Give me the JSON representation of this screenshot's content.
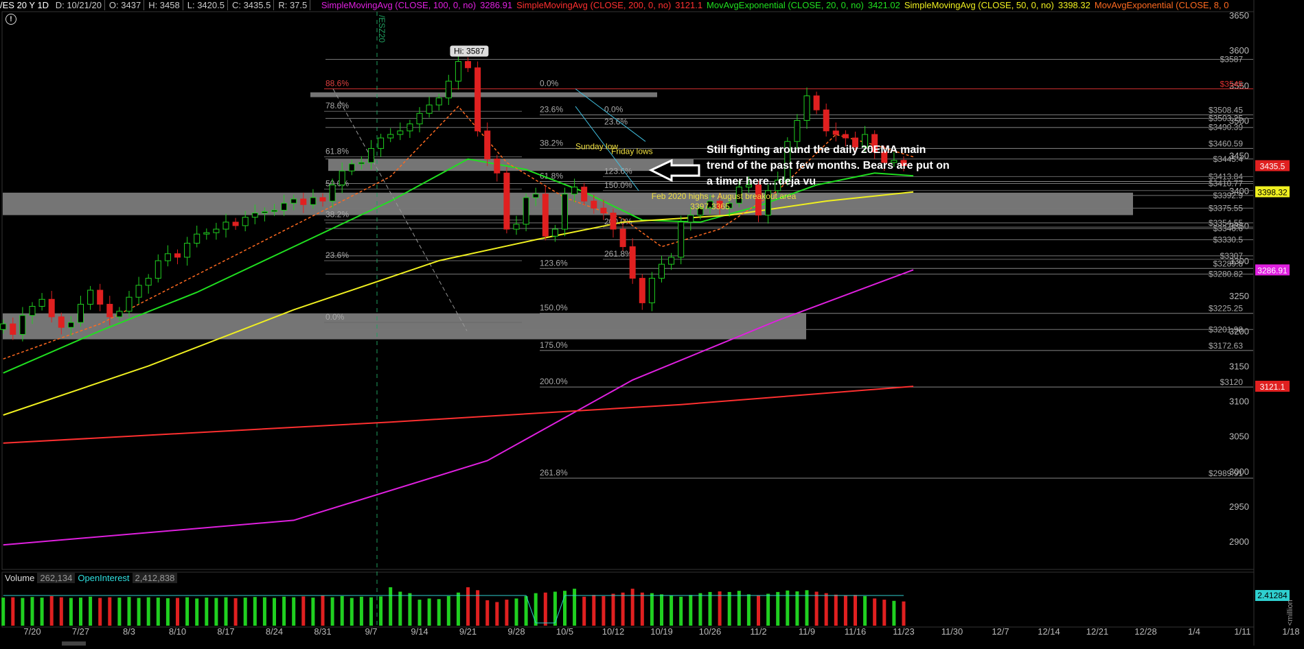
{
  "header": {
    "symbol": "/ES 20 Y 1D",
    "ohlc": [
      {
        "label": "D: 10/21/20",
        "color": "#cccccc"
      },
      {
        "label": "O: 3437",
        "color": "#cccccc"
      },
      {
        "label": "H: 3458",
        "color": "#cccccc"
      },
      {
        "label": "L: 3420.5",
        "color": "#cccccc"
      },
      {
        "label": "C: 3435.5",
        "color": "#cccccc"
      },
      {
        "label": "R: 37.5",
        "color": "#cccccc"
      }
    ],
    "studies": [
      {
        "name": "SimpleMovingAvg (CLOSE, 100, 0, no)",
        "value": "3286.91",
        "color": "#e020e0"
      },
      {
        "name": "SimpleMovingAvg (CLOSE, 200, 0, no)",
        "value": "3121.1",
        "color": "#ff3030"
      },
      {
        "name": "MovAvgExponential (CLOSE, 20, 0, no)",
        "value": "3421.02",
        "color": "#20e020"
      },
      {
        "name": "SimpleMovingAvg (CLOSE, 50, 0, no)",
        "value": "3398.32",
        "color": "#f0f020"
      },
      {
        "name": "MovAvgExponential (CLOSE, 8, 0, no)",
        "value": "",
        "color": "#ff6a20"
      }
    ]
  },
  "warning_glyph": "!",
  "contract_roll_label": "/ESZ20",
  "note": "Still fighting around the daily 20EMA main trend of the past few months. Bears are put on a timer here...deja vu",
  "chart_data": {
    "type": "candlestick",
    "ylim": [
      2860,
      3655
    ],
    "y_ticks": [
      2900,
      2950,
      3000,
      3050,
      3100,
      3150,
      3200,
      3250,
      3300,
      3350,
      3400,
      3450,
      3500,
      3550,
      3600,
      3650
    ],
    "x_ticks": [
      "7/20",
      "7/27",
      "8/3",
      "8/10",
      "8/17",
      "8/24",
      "8/31",
      "9/7",
      "9/14",
      "9/21",
      "9/28",
      "10/5",
      "10/12",
      "10/19",
      "10/26",
      "11/2",
      "11/9",
      "11/16",
      "11/23",
      "11/30",
      "12/7",
      "12/14",
      "12/21",
      "12/28",
      "1/4",
      "1/11",
      "1/18"
    ],
    "bars_per_tick": 5,
    "first_tick_index": 3,
    "hi_label": "Hi: 3587",
    "closes": [
      3210,
      3195,
      3222,
      3235,
      3245,
      3220,
      3205,
      3212,
      3238,
      3258,
      3238,
      3220,
      3228,
      3248,
      3265,
      3275,
      3300,
      3310,
      3305,
      3325,
      3338,
      3340,
      3345,
      3355,
      3350,
      3362,
      3368,
      3370,
      3372,
      3382,
      3388,
      3380,
      3390,
      3385,
      3408,
      3428,
      3438,
      3440,
      3460,
      3475,
      3480,
      3485,
      3495,
      3510,
      3522,
      3532,
      3556,
      3584,
      3575,
      3485,
      3445,
      3425,
      3345,
      3352,
      3390,
      3395,
      3335,
      3345,
      3395,
      3405,
      3385,
      3375,
      3368,
      3345,
      3320,
      3275,
      3240,
      3275,
      3295,
      3305,
      3355,
      3365,
      3375,
      3385,
      3375,
      3382,
      3405,
      3408,
      3365,
      3400,
      3415,
      3470,
      3500,
      3535,
      3515,
      3485,
      3480,
      3475,
      3462,
      3480,
      3455,
      3440,
      3443,
      3435.5
    ],
    "volume": [
      95,
      96,
      94,
      97,
      95,
      100,
      96,
      94,
      95,
      98,
      94,
      96,
      95,
      97,
      94,
      96,
      95,
      93,
      94,
      96,
      92,
      95,
      94,
      96,
      93,
      95,
      97,
      96,
      94,
      98,
      96,
      99,
      95,
      101,
      96,
      100,
      94,
      98,
      96,
      99,
      130,
      115,
      110,
      88,
      92,
      90,
      100,
      112,
      130,
      120,
      86,
      80,
      88,
      92,
      100,
      110,
      112,
      115,
      118,
      125,
      98,
      104,
      100,
      108,
      112,
      125,
      112,
      110,
      106,
      102,
      98,
      104,
      110,
      114,
      116,
      114,
      118,
      106,
      102,
      108,
      114,
      119,
      116,
      120,
      115,
      110,
      105,
      102,
      104,
      100,
      92,
      88,
      84,
      82
    ],
    "series": [
      {
        "name": "SMA 100",
        "color": "#e020e0",
        "points": [
          [
            0,
            2895
          ],
          [
            30,
            2930
          ],
          [
            50,
            3015
          ],
          [
            65,
            3130
          ],
          [
            80,
            3215
          ],
          [
            94,
            3287
          ]
        ]
      },
      {
        "name": "SMA 200",
        "color": "#ff3030",
        "points": [
          [
            0,
            3040
          ],
          [
            40,
            3070
          ],
          [
            70,
            3095
          ],
          [
            94,
            3121
          ]
        ]
      },
      {
        "name": "EMA 20",
        "color": "#20e020",
        "points": [
          [
            0,
            3140
          ],
          [
            10,
            3200
          ],
          [
            20,
            3255
          ],
          [
            30,
            3320
          ],
          [
            40,
            3385
          ],
          [
            48,
            3445
          ],
          [
            54,
            3430
          ],
          [
            60,
            3398
          ],
          [
            66,
            3358
          ],
          [
            72,
            3355
          ],
          [
            78,
            3378
          ],
          [
            84,
            3408
          ],
          [
            90,
            3425
          ],
          [
            94,
            3421
          ]
        ]
      },
      {
        "name": "SMA 50",
        "color": "#f0f020",
        "points": [
          [
            0,
            3080
          ],
          [
            15,
            3150
          ],
          [
            30,
            3230
          ],
          [
            45,
            3300
          ],
          [
            55,
            3330
          ],
          [
            64,
            3355
          ],
          [
            75,
            3365
          ],
          [
            85,
            3385
          ],
          [
            94,
            3398
          ]
        ]
      },
      {
        "name": "EMA 8",
        "color": "#ff6a20",
        "points": [
          [
            0,
            3160
          ],
          [
            10,
            3210
          ],
          [
            20,
            3280
          ],
          [
            30,
            3350
          ],
          [
            40,
            3420
          ],
          [
            47,
            3520
          ],
          [
            52,
            3440
          ],
          [
            58,
            3390
          ],
          [
            64,
            3360
          ],
          [
            68,
            3320
          ],
          [
            74,
            3345
          ],
          [
            80,
            3400
          ],
          [
            86,
            3480
          ],
          [
            90,
            3465
          ],
          [
            94,
            3448
          ]
        ]
      }
    ],
    "right_axis_badges": [
      {
        "label": "3435.5",
        "value": 3435.5,
        "color": "#e02020"
      },
      {
        "label": "3398.32",
        "value": 3398.32,
        "color": "#f0f020"
      },
      {
        "label": "3286.91",
        "value": 3286.91,
        "color": "#e020e0"
      },
      {
        "label": "3121.1",
        "value": 3121.1,
        "color": "#e02020"
      }
    ],
    "fib_levels": [
      {
        "pct": "0.0%",
        "value": 3545,
        "label": "$3545"
      },
      {
        "pct": "23.6%",
        "value": 3508,
        "label": "$3508.45"
      },
      {
        "pct": "38.2%",
        "value": 3460,
        "label": "$3460.59"
      },
      {
        "pct": "61.8%",
        "value": 3413,
        "label": "$3413.84"
      },
      {
        "pct": "123.6%",
        "value": 3289,
        "label": "$3289.8"
      },
      {
        "pct": "150.0%",
        "value": 3225,
        "label": "$3225.25"
      },
      {
        "pct": "175.0%",
        "value": 3172,
        "label": "$3172.63"
      },
      {
        "pct": "200.0%",
        "value": 3120,
        "label": "$3120"
      },
      {
        "pct": "261.8%",
        "value": 2990,
        "label": "$2989.91"
      }
    ],
    "level_prices": [
      {
        "label": "$3587",
        "value": 3587
      },
      {
        "label": "$3503.25",
        "value": 3503
      },
      {
        "label": "$3490.39",
        "value": 3490
      },
      {
        "label": "$3445.4",
        "value": 3445
      },
      {
        "label": "$3410.77",
        "value": 3410
      },
      {
        "label": "$3392.9",
        "value": 3393
      },
      {
        "label": "$3375.55",
        "value": 3375
      },
      {
        "label": "$3354.55",
        "value": 3354
      },
      {
        "label": "$3346.6",
        "value": 3346
      },
      {
        "label": "$3330.5",
        "value": 3330
      },
      {
        "label": "$3307",
        "value": 3307
      },
      {
        "label": "$3280.82",
        "value": 3281
      },
      {
        "label": "$3201.98",
        "value": 3202
      }
    ],
    "left_fib": [
      {
        "pct": "88.6%",
        "value": 3545
      },
      {
        "pct": "78.6%",
        "value": 3513
      },
      {
        "pct": "61.8%",
        "value": 3448
      },
      {
        "pct": "50.0%",
        "value": 3402
      },
      {
        "pct": "38.2%",
        "value": 3358
      },
      {
        "pct": "23.6%",
        "value": 3300
      },
      {
        "pct": "0.0%",
        "value": 3212
      }
    ],
    "mid_fib": [
      {
        "pct": "0.0%",
        "value": 3508
      },
      {
        "pct": "23.6%",
        "value": 3490
      },
      {
        "pct": "123.6%",
        "value": 3420
      },
      {
        "pct": "150.0%",
        "value": 3400
      },
      {
        "pct": "200.0%",
        "value": 3348
      },
      {
        "pct": "261.8%",
        "value": 3302
      }
    ],
    "zone_label": "Feb 2020 highs + August breakout area",
    "zone_range": "3397-3365",
    "sunday_low": "Sunday low",
    "friday_lows": "Friday lows",
    "volume_panel": {
      "label": "Volume",
      "value": "262,134",
      "oi_label": "OpenInterest",
      "oi_value": "2,412,838",
      "badge": "2.41284",
      "unit": "<million"
    }
  }
}
